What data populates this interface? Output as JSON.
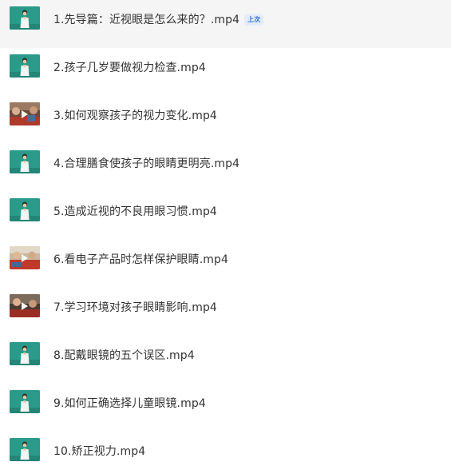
{
  "playlist": {
    "items": [
      {
        "title": "1.先导篇：近视眼是怎么来的？.mp4",
        "badge": "上次",
        "thumb": "lecturer",
        "active": true
      },
      {
        "title": "2.孩子几岁要做视力检查.mp4",
        "thumb": "lecturer"
      },
      {
        "title": "3.如何观察孩子的视力变化.mp4",
        "thumb": "classroom"
      },
      {
        "title": "4.合理膳食使孩子的眼睛更明亮.mp4",
        "thumb": "lecturer"
      },
      {
        "title": "5.造成近视的不良用眼习惯.mp4",
        "thumb": "lecturer"
      },
      {
        "title": "6.看电子产品时怎样保护眼睛.mp4",
        "thumb": "classroom"
      },
      {
        "title": "7.学习环境对孩子眼睛影响.mp4",
        "thumb": "classroom"
      },
      {
        "title": "8.配戴眼镜的五个误区.mp4",
        "thumb": "lecturer"
      },
      {
        "title": "9.如何正确选择儿童眼镜.mp4",
        "thumb": "lecturer"
      },
      {
        "title": "10.矫正视力.mp4",
        "thumb": "lecturer"
      }
    ]
  },
  "colors": {
    "thumb_teal": "#2a9a8a",
    "badge_text": "#2f6bd8",
    "badge_bg": "#e3ecfc",
    "active_row_bg": "#f5f5f5"
  }
}
